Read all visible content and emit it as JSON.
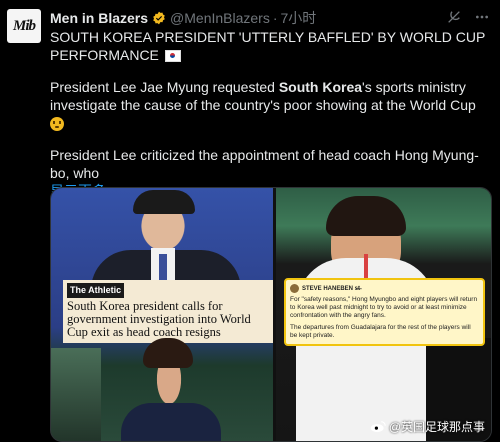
{
  "account": {
    "avatar_text": "Mib",
    "name": "Men in Blazers",
    "handle": "@MenInBlazers",
    "separator": "·",
    "time": "7小时"
  },
  "tweet": {
    "headline": "SOUTH KOREA PRESIDENT 'UTTERLY BAFFLED' BY WORLD CUP PERFORMANCE",
    "p2_a": "President Lee Jae Myung requested ",
    "p2_bold": "South Korea",
    "p2_b": "'s sports ministry investigate the cause of the country's poor showing at the World Cup",
    "p3": "President Lee criticized the appointment of head coach Hong Myung-bo, who",
    "show_more": "显示更多"
  },
  "media": {
    "left_tag": "The Athletic",
    "left_caption": "South Korea president calls for government investigation into World Cup exit as head coach resigns",
    "card_author": "STEVE HANEBEN s̶t̶",
    "card_p1": "For \"safety reasons,\" Hong Myungbo and eight players will return to Korea well past midnight to try to avoid or at least minimize confrontation with the angry fans.",
    "card_p2": "The departures from Guadalajara for the rest of the players will be kept private."
  },
  "watermark": {
    "text": "@英国足球那点事"
  },
  "colors": {
    "background": "#000000",
    "link": "#1d9bf0",
    "muted": "#71767b",
    "verified": "#f2b91f"
  }
}
